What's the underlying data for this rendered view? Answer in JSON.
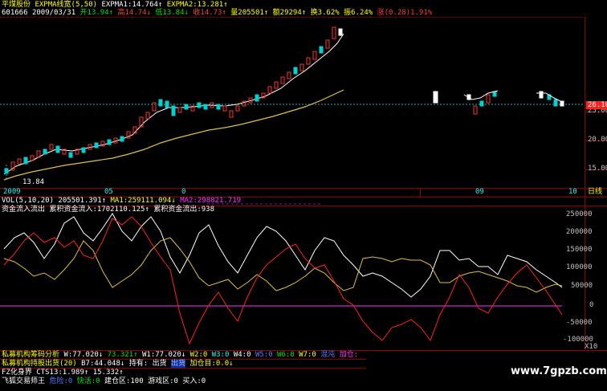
{
  "header": {
    "stock_name": "平煤股份",
    "indicator": "EXPMA线宽(5,50)",
    "ema1": "EXPMA1:14.764↑",
    "ema2": "EXPMA2:13.281↑"
  },
  "quote": {
    "code": "601666",
    "date": "2009/03/31",
    "open": "开13.94↑",
    "high": "高14.74↓",
    "low": "低13.84↓",
    "close": "收14.73↑",
    "volume": "量205501↑",
    "amount": "额29294↑",
    "turnover": "换3.62%",
    "amplitude": "振6.24%",
    "change": "涨(0.28)1.91%"
  },
  "price_axis": [
    "25.00",
    "20.00",
    "15.00"
  ],
  "current_price": "26.10",
  "low_mark": "13.84",
  "time_axis": {
    "left": [
      "2009",
      "05",
      "0"
    ],
    "right": [
      "09",
      "10"
    ],
    "period": "日线"
  },
  "vol_panel": {
    "label": "VOL(5,10,20)",
    "v1": "205501.391↑",
    "ma1": "MA1:259111.094↓",
    "ma2": "MA2:298821.719"
  },
  "flow_panel": {
    "label": "资金流入流出",
    "inflow": "累积资金流入:1702110.125↑",
    "outflow": "累积资金流出:938"
  },
  "flow_axis": [
    "250000",
    "200000",
    "150000",
    "100000",
    "50000",
    "0",
    "-50000",
    "-100000"
  ],
  "flow_axis_unit": "X10",
  "bottom": {
    "row1": {
      "name": "私募机构筹码分析",
      "w": "W:77.020↓",
      "g1": "73.321↑",
      "w1": "W1:77.020↓",
      "w2": "W2:0",
      "w3": "W3:0",
      "w4": "W4:0",
      "w5": "W5:0",
      "w6": "W6:0",
      "w7": "W7:0",
      "w8": "混沌",
      "add": "加仓:"
    },
    "row2": {
      "name": "私募机构持股出货(20)",
      "b7": "B7:44.048↓",
      "hold": "持有:",
      "out": "出货",
      "out2": "出货",
      "add": "加仓目:0.0↓"
    },
    "row3": {
      "name": "FZ化身界",
      "cts": "CTS13:1.989↑",
      "v": "15.332↑"
    },
    "row4": {
      "name": "飞狐交易师王",
      "a": "危险:0",
      "b": "快活:0",
      "c": "建仓区:100",
      "d": "游戏区:0",
      "e": "买入:0"
    }
  },
  "watermark": "www.7gpzb.com"
}
